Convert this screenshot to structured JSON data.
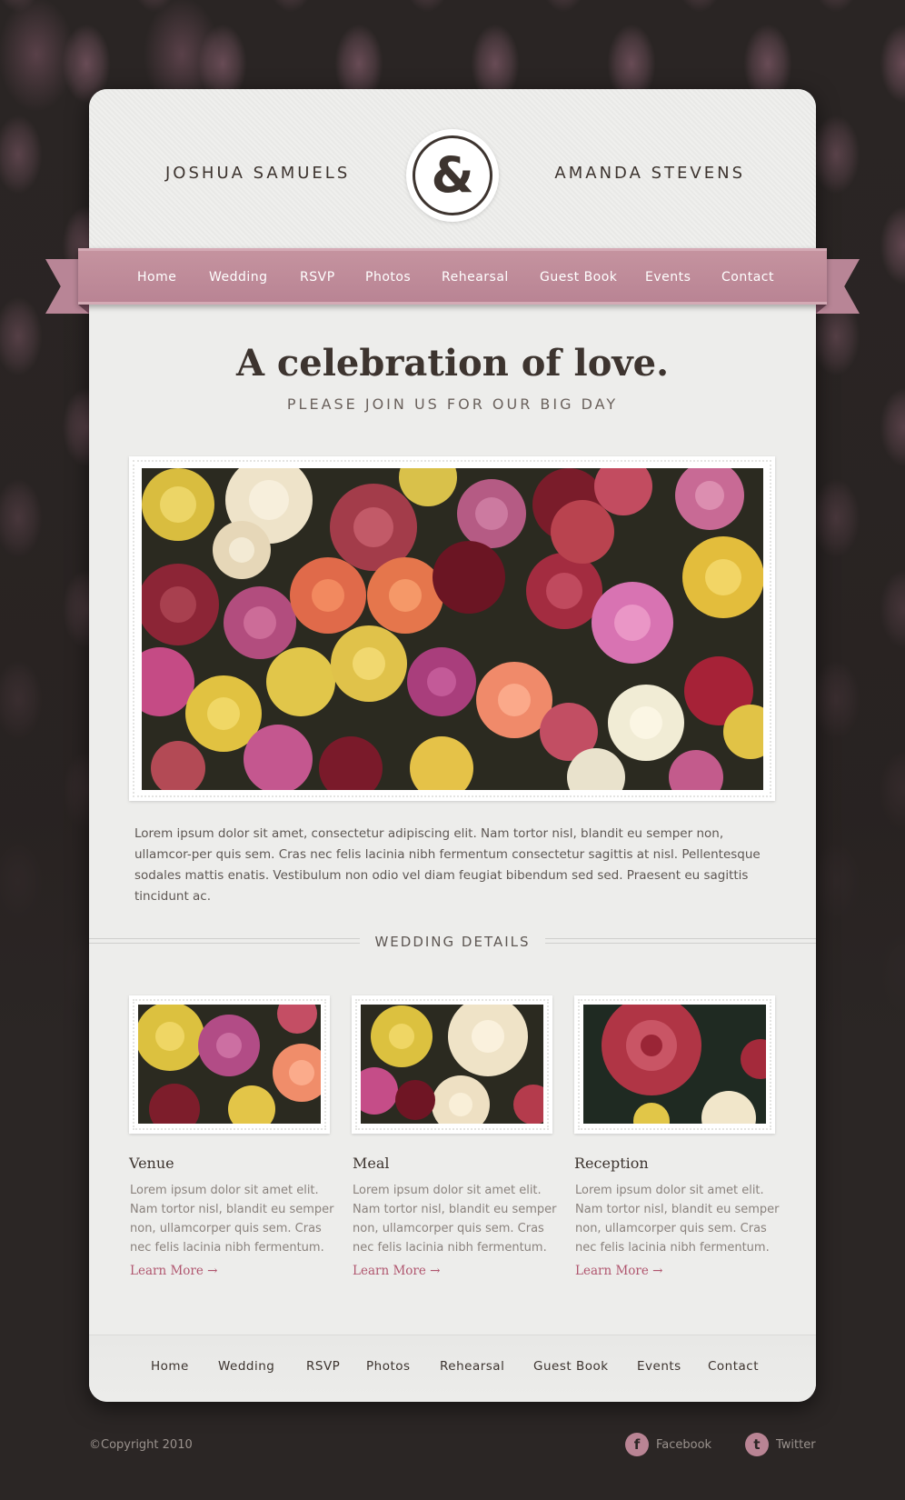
{
  "header": {
    "groom": "JOSHUA SAMUELS",
    "bride": "AMANDA STEVENS",
    "ampersand": "&"
  },
  "nav": {
    "items": [
      "Home",
      "Wedding",
      "RSVP",
      "Photos",
      "Rehearsal",
      "Guest Book",
      "Events",
      "Contact"
    ]
  },
  "hero": {
    "title": "A celebration of love.",
    "subtitle": "PLEASE JOIN US FOR OUR BIG DAY",
    "image": "roses-bouquet-photo",
    "body": "Lorem ipsum dolor sit amet, consectetur adipiscing elit. Nam tortor nisl, blandit eu semper non, ullamcor-per quis sem. Cras nec felis lacinia nibh fermentum consectetur sagittis at nisl. Pellentesque sodales mattis enatis. Vestibulum non odio vel diam feugiat bibendum sed sed. Praesent eu  sagittis tincidunt ac."
  },
  "details": {
    "title": "WEDDING DETAILS",
    "columns": [
      {
        "title": "Venue",
        "text": "Lorem ipsum dolor sit amet elit. Nam tortor nisl, blandit eu semper non, ullamcorper quis sem. Cras nec felis lacinia nibh fermentum.",
        "link": "Learn More →",
        "image": "roses-photo-1"
      },
      {
        "title": "Meal",
        "text": "Lorem ipsum dolor sit amet elit. Nam tortor nisl, blandit eu semper non, ullamcorper quis sem. Cras nec felis lacinia nibh fermentum.",
        "link": "Learn More →",
        "image": "roses-photo-2"
      },
      {
        "title": "Reception",
        "text": "Lorem ipsum dolor sit amet elit. Nam tortor nisl, blandit eu semper non, ullamcorper quis sem. Cras nec felis lacinia nibh fermentum.",
        "link": "Learn More →",
        "image": "roses-photo-3"
      }
    ]
  },
  "footer": {
    "nav": [
      "Home",
      "Wedding",
      "RSVP",
      "Photos",
      "Rehearsal",
      "Guest Book",
      "Events",
      "Contact"
    ],
    "copyright": "©Copyright 2010",
    "social": [
      {
        "label": "Facebook",
        "icon": "facebook-icon",
        "glyph": "f"
      },
      {
        "label": "Twitter",
        "icon": "twitter-icon",
        "glyph": "t"
      }
    ]
  },
  "colors": {
    "background": "#2a2524",
    "card": "#ededeb",
    "ribbon": "#b98494",
    "text_dark": "#3d342f",
    "link": "#b0566f"
  }
}
